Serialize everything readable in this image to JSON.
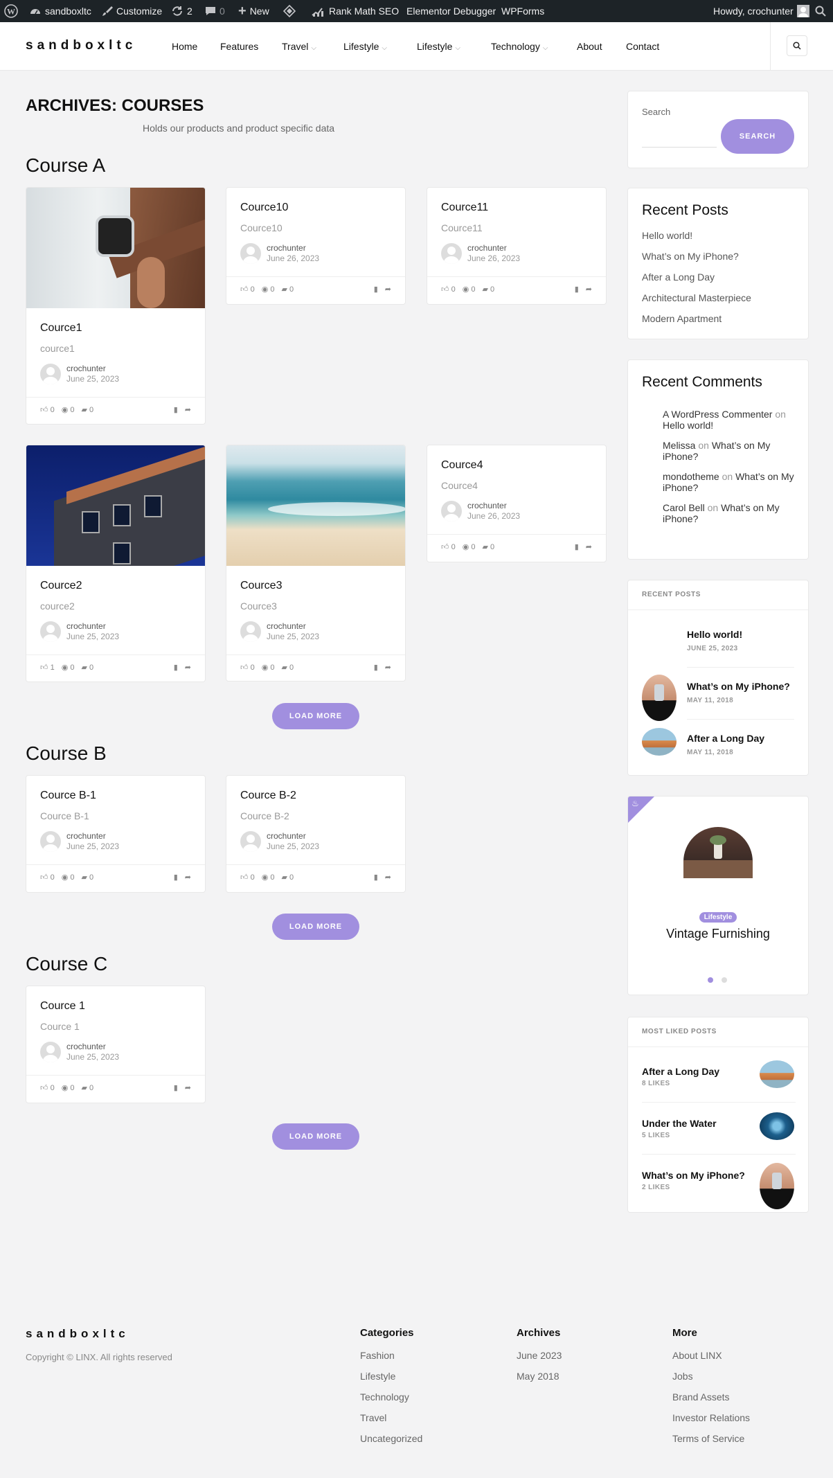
{
  "admin_bar": {
    "site": "sandboxltc",
    "customize": "Customize",
    "updates": "2",
    "comments": "0",
    "new": "New",
    "rankmath": "Rank Math SEO",
    "elementor": "Elementor Debugger",
    "wpforms": "WPForms",
    "howdy": "Howdy, crochunter"
  },
  "header": {
    "logo": "sandboxltc",
    "nav": [
      "Home",
      "Features",
      "Travel",
      "Lifestyle",
      "Lifestyle",
      "Technology",
      "About",
      "Contact"
    ]
  },
  "archive": {
    "title": "ARCHIVES: COURSES",
    "description": "Holds our products and product specific data",
    "load_more": "LOAD MORE"
  },
  "sections": [
    {
      "title": "Course A",
      "cards": [
        {
          "title": "Cource1",
          "excerpt": "cource1",
          "author": "crochunter",
          "date": "June 25, 2023",
          "likes": "0",
          "views": "0",
          "comments": "0",
          "image": "watch"
        },
        {
          "title": "Cource10",
          "excerpt": "Cource10",
          "author": "crochunter",
          "date": "June 26, 2023",
          "likes": "0",
          "views": "0",
          "comments": "0"
        },
        {
          "title": "Cource11",
          "excerpt": "Cource11",
          "author": "crochunter",
          "date": "June 26, 2023",
          "likes": "0",
          "views": "0",
          "comments": "0"
        },
        {
          "title": "Cource2",
          "excerpt": "cource2",
          "author": "crochunter",
          "date": "June 25, 2023",
          "likes": "1",
          "views": "0",
          "comments": "0",
          "image": "building"
        },
        {
          "title": "Cource3",
          "excerpt": "Cource3",
          "author": "crochunter",
          "date": "June 25, 2023",
          "likes": "0",
          "views": "0",
          "comments": "0",
          "image": "beach"
        },
        {
          "title": "Cource4",
          "excerpt": "Cource4",
          "author": "crochunter",
          "date": "June 26, 2023",
          "likes": "0",
          "views": "0",
          "comments": "0"
        }
      ]
    },
    {
      "title": "Course B",
      "cards": [
        {
          "title": "Cource B-1",
          "excerpt": "Cource B-1",
          "author": "crochunter",
          "date": "June 25, 2023",
          "likes": "0",
          "views": "0",
          "comments": "0"
        },
        {
          "title": "Cource B-2",
          "excerpt": "Cource B-2",
          "author": "crochunter",
          "date": "June 25, 2023",
          "likes": "0",
          "views": "0",
          "comments": "0"
        }
      ]
    },
    {
      "title": "Course C",
      "cards": [
        {
          "title": "Cource 1",
          "excerpt": "Cource 1",
          "author": "crochunter",
          "date": "June 25, 2023",
          "likes": "0",
          "views": "0",
          "comments": "0"
        }
      ]
    }
  ],
  "sidebar": {
    "search": {
      "label": "Search",
      "button": "SEARCH"
    },
    "recent_posts": {
      "title": "Recent Posts",
      "items": [
        "Hello world!",
        "What’s on My iPhone?",
        "After a Long Day",
        "Architectural Masterpiece",
        "Modern Apartment"
      ]
    },
    "recent_comments": {
      "title": "Recent Comments",
      "on": "on",
      "items": [
        {
          "author": "A WordPress Commenter",
          "post": "Hello world!"
        },
        {
          "author": "Melissa",
          "post": "What’s on My iPhone?"
        },
        {
          "author": "mondotheme",
          "post": "What’s on My iPhone?"
        },
        {
          "author": "Carol Bell",
          "post": "What’s on My iPhone?"
        }
      ]
    },
    "recent_posts_thumbs": {
      "title": "RECENT POSTS",
      "items": [
        {
          "title": "Hello world!",
          "date": "JUNE 25, 2023"
        },
        {
          "title": "What’s on My iPhone?",
          "date": "MAY 11, 2018"
        },
        {
          "title": "After a Long Day",
          "date": "MAY 11, 2018"
        }
      ]
    },
    "featured": {
      "category": "Lifestyle",
      "title": "Vintage Furnishing",
      "dots": 2,
      "active_dot": 1
    },
    "most_liked": {
      "title": "MOST LIKED POSTS",
      "items": [
        {
          "title": "After a Long Day",
          "likes": "8 LIKES"
        },
        {
          "title": "Under the Water",
          "likes": "5 LIKES"
        },
        {
          "title": "What’s on My iPhone?",
          "likes": "2 LIKES"
        }
      ]
    }
  },
  "footer": {
    "logo": "sandboxltc",
    "copyright": "Copyright © LINX. All rights reserved",
    "categories": {
      "title": "Categories",
      "items": [
        "Fashion",
        "Lifestyle",
        "Technology",
        "Travel",
        "Uncategorized"
      ]
    },
    "archives": {
      "title": "Archives",
      "items": [
        "June 2023",
        "May 2018"
      ]
    },
    "more": {
      "title": "More",
      "items": [
        "About LINX",
        "Jobs",
        "Brand Assets",
        "Investor Relations",
        "Terms of Service"
      ]
    }
  },
  "colors": {
    "accent": "#a18fdf",
    "admin_bar": "#1d2327",
    "background": "#f3f3f4"
  }
}
